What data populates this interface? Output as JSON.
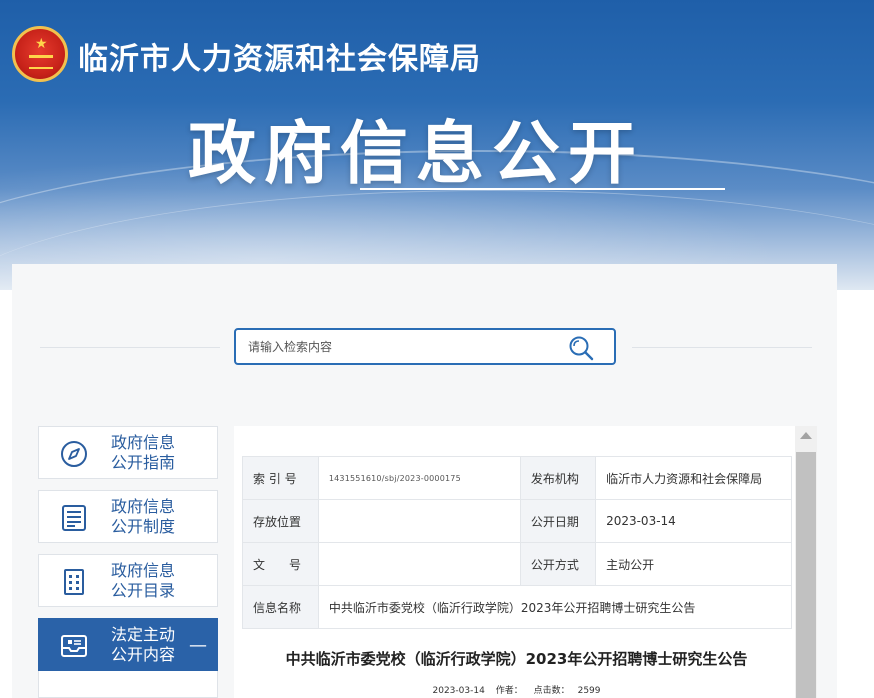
{
  "header": {
    "org_name": "临沂市人力资源和社会保障局",
    "section_title": "政府信息公开"
  },
  "search": {
    "placeholder": "请输入检索内容",
    "icon": "search-icon"
  },
  "sidebar": {
    "items": [
      {
        "label_line1": "政府信息",
        "label_line2": "公开指南",
        "icon": "compass-icon",
        "active": false
      },
      {
        "label_line1": "政府信息",
        "label_line2": "公开制度",
        "icon": "document-list-icon",
        "active": false
      },
      {
        "label_line1": "政府信息",
        "label_line2": "公开目录",
        "icon": "catalog-icon",
        "active": false
      },
      {
        "label_line1": "法定主动",
        "label_line2": "公开内容",
        "icon": "inbox-icon",
        "active": true,
        "toggle": "—"
      }
    ]
  },
  "meta_table": {
    "index_label": "索 引 号",
    "index_value": "1431551610/sbj/2023-0000175",
    "publisher_label": "发布机构",
    "publisher_value": "临沂市人力资源和社会保障局",
    "storage_label": "存放位置",
    "storage_value": "",
    "date_label": "公开日期",
    "date_value": "2023-03-14",
    "doc_no_label": "文　号",
    "doc_no_value": "",
    "method_label": "公开方式",
    "method_value": "主动公开",
    "name_label": "信息名称",
    "name_value": "中共临沂市委党校（临沂行政学院）2023年公开招聘博士研究生公告"
  },
  "article": {
    "title": "中共临沂市委党校（临沂行政学院）2023年公开招聘博士研究生公告",
    "date": "2023-03-14",
    "author_label": "作者：",
    "views_label": "点击数：",
    "views": "2599"
  },
  "colors": {
    "brand_blue": "#2a62a8",
    "nav_text": "#2a5d9f",
    "banner_top": "#1f5fa9"
  }
}
